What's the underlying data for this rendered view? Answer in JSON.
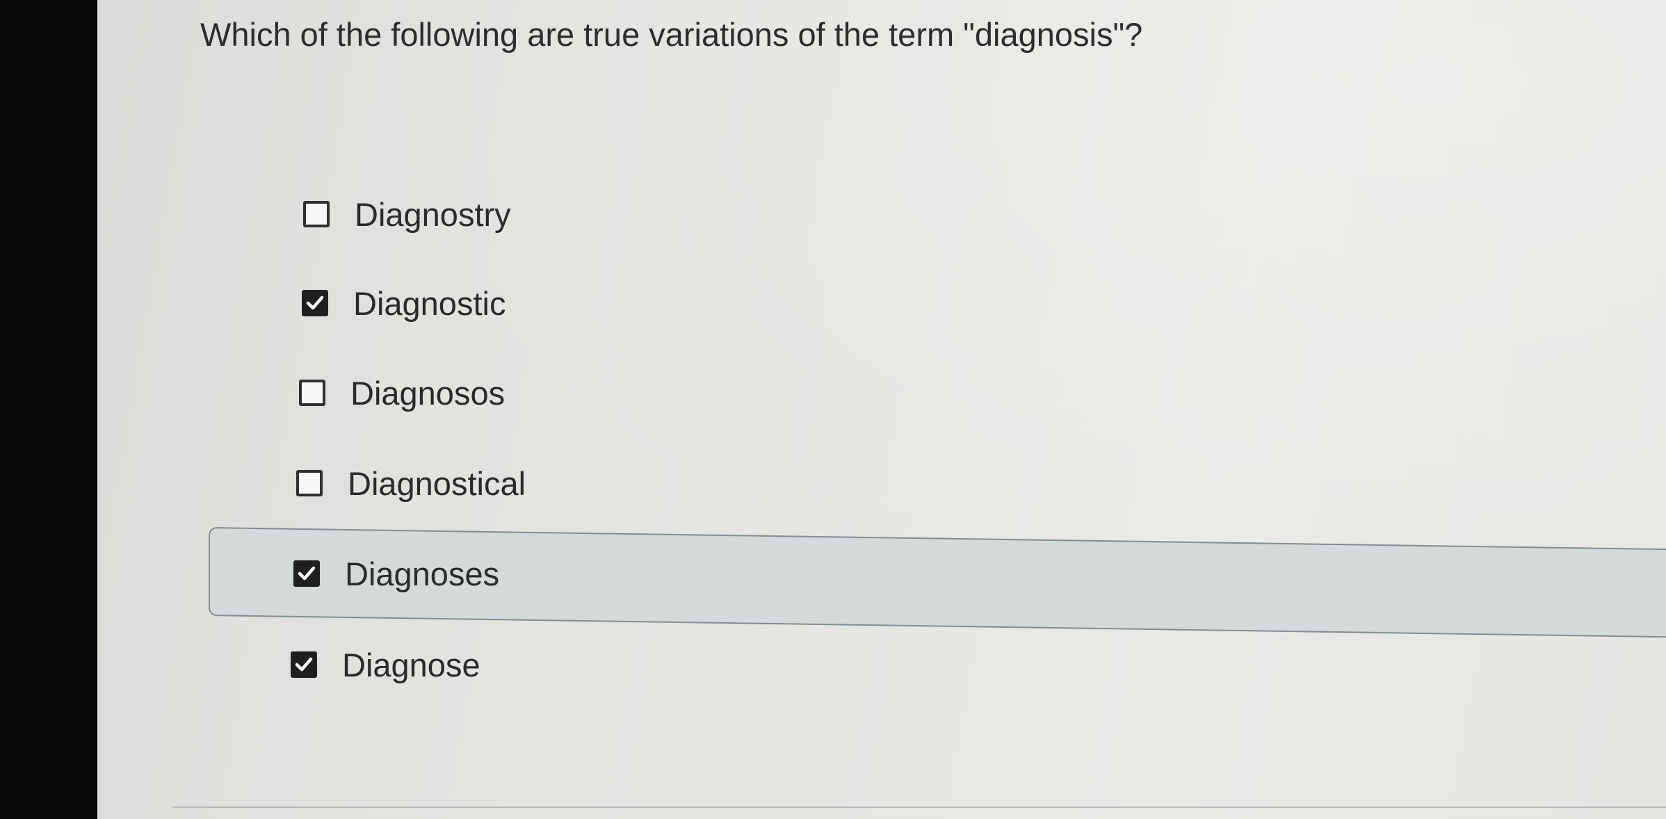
{
  "question": {
    "text": "Which of the following are true variations of the term \"diagnosis\"?"
  },
  "options": [
    {
      "label": "Diagnostry",
      "checked": false,
      "highlighted": false
    },
    {
      "label": "Diagnostic",
      "checked": true,
      "highlighted": false
    },
    {
      "label": "Diagnosos",
      "checked": false,
      "highlighted": false
    },
    {
      "label": "Diagnostical",
      "checked": false,
      "highlighted": false
    },
    {
      "label": "Diagnoses",
      "checked": true,
      "highlighted": true
    },
    {
      "label": "Diagnose",
      "checked": true,
      "highlighted": false
    }
  ],
  "icons": {
    "checked": "checkmark-icon",
    "unchecked": "empty-checkbox"
  },
  "colors": {
    "highlight_fill": "#d3dad9",
    "highlight_border": "#7f8e91",
    "checkbox_checked": "#1f1f1f",
    "text": "#2a2a2a"
  }
}
